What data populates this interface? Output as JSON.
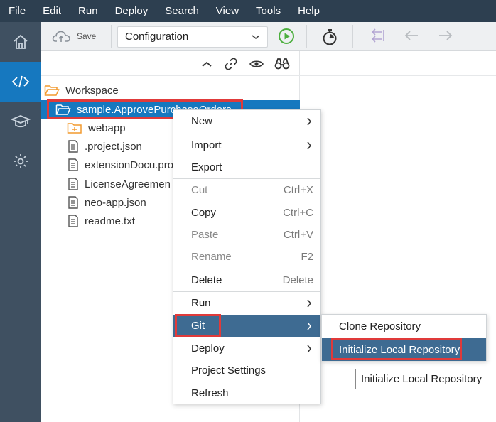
{
  "menubar": {
    "items": [
      "File",
      "Edit",
      "Run",
      "Deploy",
      "Search",
      "View",
      "Tools",
      "Help"
    ]
  },
  "rail": {
    "items": [
      {
        "icon": "home-icon"
      },
      {
        "icon": "code-icon",
        "active": true
      },
      {
        "icon": "graduation-cap-icon"
      },
      {
        "icon": "gear-icon"
      }
    ]
  },
  "toolbar": {
    "save_label": "Save",
    "run_config": "Configuration"
  },
  "workspace": {
    "root_label": "Workspace",
    "project_label": "sample.ApprovePurchaseOrders",
    "children": [
      {
        "label": "webapp",
        "icon": "folder-icon"
      },
      {
        "label": ".project.json",
        "icon": "file-icon"
      },
      {
        "label": "extensionDocu.pro",
        "icon": "file-icon"
      },
      {
        "label": "LicenseAgreemen",
        "icon": "file-icon"
      },
      {
        "label": "neo-app.json",
        "icon": "file-icon"
      },
      {
        "label": "readme.txt",
        "icon": "file-icon"
      }
    ]
  },
  "context_menu": {
    "new": "New",
    "import": "Import",
    "export": "Export",
    "cut": "Cut",
    "cut_shortcut": "Ctrl+X",
    "copy": "Copy",
    "copy_shortcut": "Ctrl+C",
    "paste": "Paste",
    "paste_shortcut": "Ctrl+V",
    "rename": "Rename",
    "rename_shortcut": "F2",
    "delete": "Delete",
    "delete_shortcut": "Delete",
    "run": "Run",
    "git": "Git",
    "deploy": "Deploy",
    "project_settings": "Project Settings",
    "refresh": "Refresh"
  },
  "git_submenu": {
    "clone": "Clone Repository",
    "init": "Initialize Local Repository"
  },
  "tooltip": "Initialize Local Repository",
  "colors": {
    "menubar": "#2d3f50",
    "rail": "#3f5061",
    "active": "#1678bf",
    "menu_highlight": "#3e6b92",
    "annotation_red": "#e03a3a"
  }
}
